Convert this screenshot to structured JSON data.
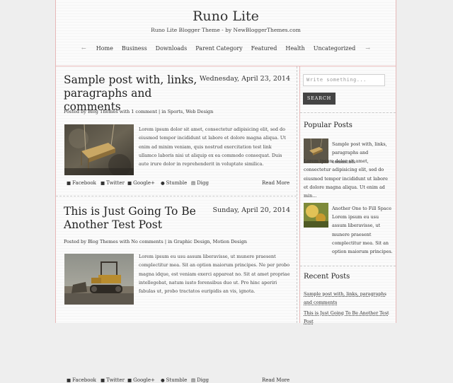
{
  "site": {
    "title": "Runo Lite",
    "tagline": "Runo Lite Blogger Theme - by NewBloggerThemes.com"
  },
  "nav": {
    "prev_arrow": "←",
    "next_arrow": "→",
    "items": [
      "Home",
      "Business",
      "Downloads",
      "Parent Category",
      "Featured",
      "Health",
      "Uncategorized"
    ]
  },
  "posts": [
    {
      "title": "Sample post with, links, paragraphs and comments",
      "date": "Wednesday, April 23, 2014",
      "meta": "Posted by Blog Themes with 1 comment | in Sports, Web Design",
      "excerpt": "Lorem ipsum dolor sit amet, consectetur adipisicing elit, sed do eiusmod tempor incididunt ut labore et dolore magna aliqua. Ut enim ad minim veniam, quis nostrud exercitation test link ullamco laboris nisi ut aliquip ex ea commodo consequat. Duis aute irure dolor in reprehenderit in voluptate similica.",
      "read_more": "Read More"
    },
    {
      "title": "This is Just Going To Be Another Test Post",
      "date": "Sunday, April 20, 2014",
      "meta": "Posted by Blog Themes with No comments | in Graphic Design, Motion Design",
      "excerpt": "Lorem ipsum eu usu assum liberavisse, ut munere praesent complectitur mea. Sit an option maiorum principes. Ne per probo magna idque, est veniam exerci appareat no. Sit at amet propriae intellegebat, natum iusto forensibus duo ut. Pro hinc aperiri fabulas ut, probo tractatos euripidis an vis, ignota.",
      "read_more": "Read More"
    }
  ],
  "share": [
    "Facebook",
    "Twitter",
    "Google+",
    "Stumble",
    "Digg"
  ],
  "sidebar": {
    "search_placeholder": "Write something...",
    "search_button": "SEARCH",
    "popular_title": "Popular Posts",
    "popular": [
      {
        "text_a": "Sample post with, links, paragraphs and comments",
        "text_b": "Lorem ipsum dolor sit amet, consectetur adipisicing elit, sed do eiusmod tempor incididunt ut labore et dolore magna aliqua. Ut enim ad min..."
      },
      {
        "text_a": "Another One to Fill Space",
        "text_b": "Lorem ipsum eu usu assum liberavisse, ut munere praesent complectitur mea. Sit an option maiorum principes. Ne per probo magna idque, est ve..."
      }
    ],
    "recent_title": "Recent Posts",
    "recent": [
      "Sample post with, links, paragraphs and comments",
      "This is Just Going To Be Another Test Post"
    ]
  },
  "colors": {
    "accent_border": "#e7b8b8",
    "button_bg": "#444444",
    "page_bg": "#fbfbfb"
  }
}
